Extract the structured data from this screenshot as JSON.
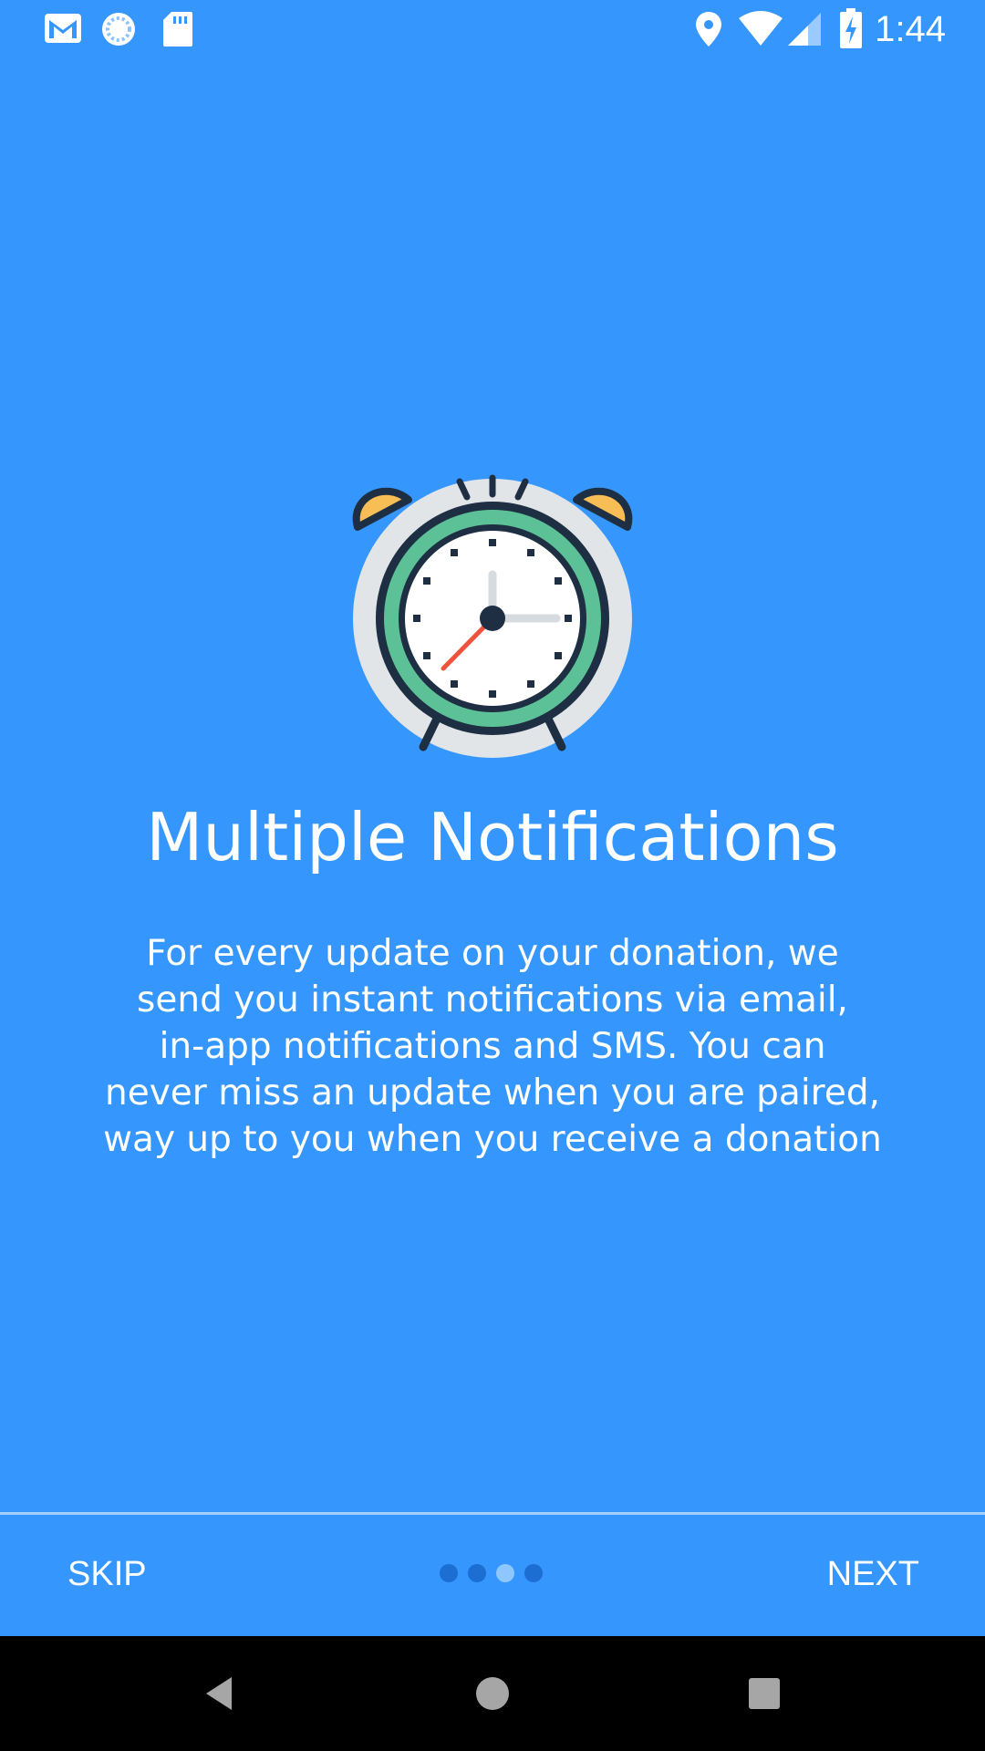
{
  "status_bar": {
    "time": "1:44",
    "icons": [
      "gmail-icon",
      "sync-icon",
      "sd-card-icon",
      "location-icon",
      "wifi-icon",
      "cell-signal-icon",
      "battery-charging-icon"
    ]
  },
  "onboarding": {
    "illustration": "alarm-clock-icon",
    "title": "Multiple Notifications",
    "description_lines": [
      "For every update on your donation, we",
      "send you instant notifications via email,",
      "in-app notifications and SMS. You can",
      "never miss an update when you are paired,",
      "way up to you when you receive a donation"
    ]
  },
  "pager": {
    "skip_label": "SKIP",
    "next_label": "NEXT",
    "page_count": 4,
    "current_page": 3
  },
  "nav_bar": {
    "buttons": [
      "back-icon",
      "home-icon",
      "recents-icon"
    ]
  },
  "colors": {
    "background": "#3596FE",
    "dot_inactive": "#1D6ED2",
    "dot_active": "#8EC6FF",
    "clock_ring": "#5CC196",
    "clock_bells": "#F7BE55",
    "clock_outline": "#1E2E43",
    "clock_backdrop": "#E1E5E8",
    "second_hand": "#F0533D"
  }
}
